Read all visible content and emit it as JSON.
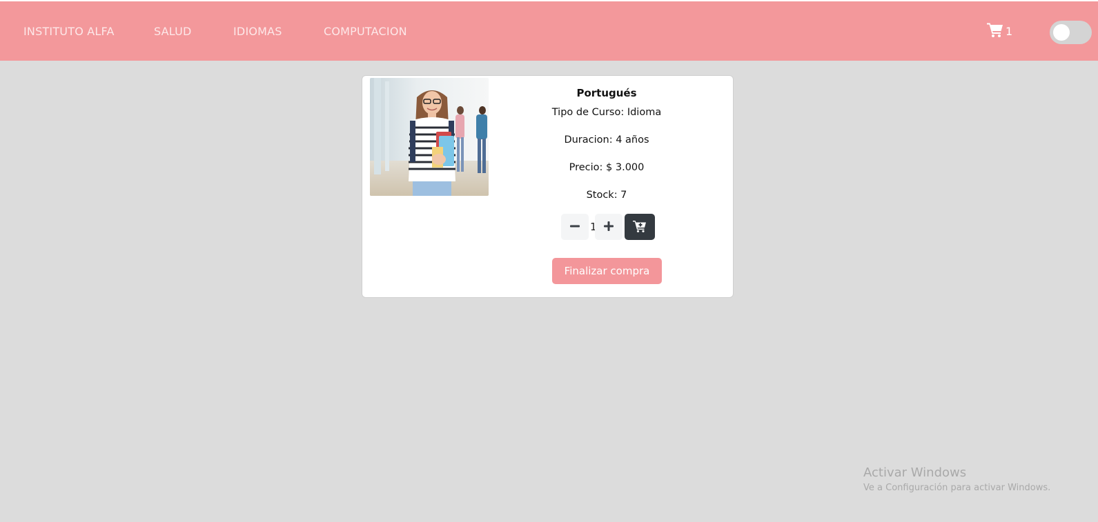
{
  "navbar": {
    "brand": "INSTITUTO ALFA",
    "links": [
      "SALUD",
      "IDIOMAS",
      "COMPUTACION"
    ],
    "cart_count": "1",
    "theme_toggle_on": false
  },
  "product": {
    "title": "Portugués",
    "tipo": "Tipo de Curso: Idioma",
    "duracion": "Duracion: 4 años",
    "precio": "Precio: $ 3.000",
    "stock": "Stock: 7",
    "quantity": "1",
    "finish_label": "Finalizar compra",
    "image_alt": "student-holding-books-photo"
  },
  "watermark": {
    "title": "Activar Windows",
    "subtitle": "Ve a Configuración para activar Windows."
  },
  "colors": {
    "navbar": "#f3989b",
    "background": "#dcdcdc",
    "accent_button": "#f3969a",
    "dark_button": "#343a40"
  }
}
